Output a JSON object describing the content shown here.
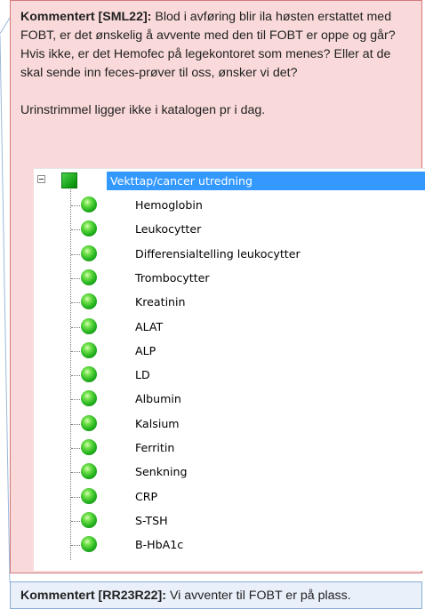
{
  "comments": [
    {
      "author_label": "Kommentert [SML22]:",
      "paragraphs": [
        "Blod i avføring blir ila høsten erstattet med FOBT, er det ønskelig å avvente med den til FOBT er oppe og går? Hvis ikke, er det Hemofec på legekontoret som menes? Eller at de skal sende inn feces-prøver til oss, ønsker vi det?",
        "Urinstrimmel ligger ikke i katalogen pr i dag."
      ]
    },
    {
      "author_label": "Kommentert [RR23R22]:",
      "text": "Vi avventer til FOBT er på plass."
    }
  ],
  "tree": {
    "parent_label": "Vekttap/cancer utredning",
    "children": [
      "Hemoglobin",
      "Leukocytter",
      "Differensialtelling leukocytter",
      "Trombocytter",
      "Kreatinin",
      "ALAT",
      "ALP",
      "LD",
      "Albumin",
      "Kalsium",
      "Ferritin",
      "Senkning",
      "CRP",
      "S-TSH",
      "B-HbA1c"
    ]
  },
  "colors": {
    "comment1_bg": "#f9d9d9",
    "comment2_bg": "#e9f0fa",
    "selection": "#3399ff",
    "status_green": "#23b21e"
  }
}
